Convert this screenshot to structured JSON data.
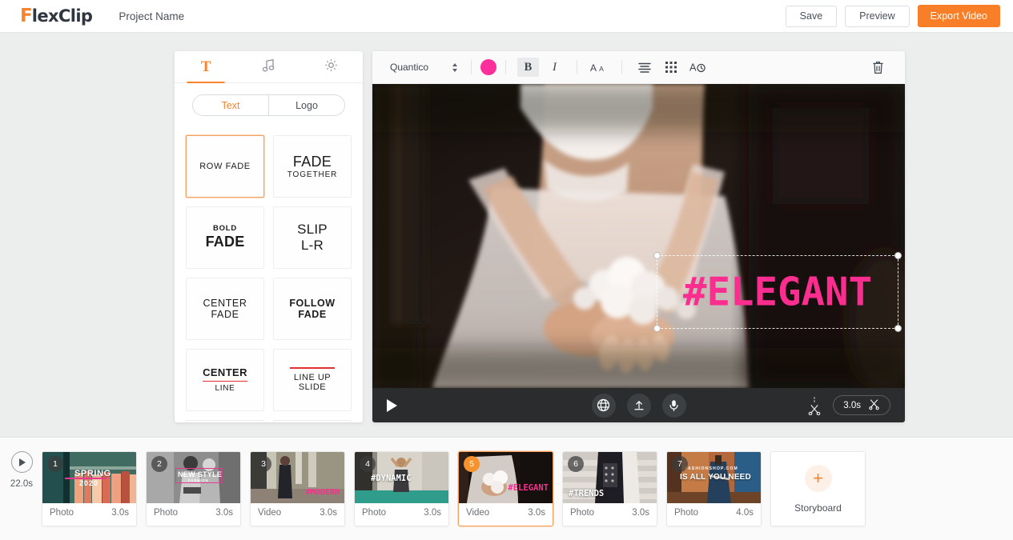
{
  "header": {
    "logo_f": "F",
    "logo_rest": "lexClip",
    "project_name": "Project Name",
    "save_label": "Save",
    "preview_label": "Preview",
    "export_label": "Export Video"
  },
  "left_panel": {
    "tabs": [
      {
        "icon": "text-T-icon",
        "label": "T",
        "active": true
      },
      {
        "icon": "music-note-icon",
        "label": "",
        "active": false
      },
      {
        "icon": "gear-icon",
        "label": "",
        "active": false
      }
    ],
    "segmented": [
      {
        "label": "Text",
        "active": true
      },
      {
        "label": "Logo",
        "active": false
      }
    ],
    "presets": [
      {
        "line1": "ROW FADE",
        "line2": "",
        "style": "rowfade",
        "selected": true
      },
      {
        "line1": "FADE",
        "line2": "TOGETHER",
        "style": "fade",
        "selected": false
      },
      {
        "line1": "BOLD",
        "line2": "FADE",
        "style": "boldfade",
        "selected": false
      },
      {
        "line1": "SLIP",
        "line2": "L-R",
        "style": "slip",
        "selected": false
      },
      {
        "line1": "CENTER",
        "line2": "FADE",
        "style": "centerfade",
        "selected": false
      },
      {
        "line1": "FOLLOW",
        "line2": "FADE",
        "style": "followfade",
        "selected": false
      },
      {
        "line1": "CENTER",
        "line2": "LINE",
        "style": "centerline",
        "selected": false
      },
      {
        "line1": "LINE UP",
        "line2": "SLIDE",
        "style": "lineupslide",
        "selected": false
      }
    ]
  },
  "text_toolbar": {
    "font_name": "Quantico",
    "color": "#fb2e9b",
    "bold_label": "B",
    "italic_label": "I",
    "bold_active": true,
    "icons": [
      "font-size-icon",
      "align-icon",
      "spacing-grid-icon",
      "text-animation-icon",
      "trash-icon"
    ]
  },
  "preview": {
    "overlay_text": "#ELEGANT",
    "overlay_color": "#fb2e8f",
    "player": {
      "play_label": "play-icon",
      "buttons": [
        "globe-icon",
        "upload-icon",
        "microphone-icon"
      ],
      "split_label": "split-icon",
      "duration": "3.0s",
      "trim_label": "scissors-icon"
    }
  },
  "timeline": {
    "total_duration": "22.0s",
    "items": [
      {
        "index": "1",
        "type": "Photo",
        "duration": "3.0s",
        "selected": false,
        "overlay": {
          "kind": "spring",
          "line1": "SPRING",
          "line2": "2020"
        }
      },
      {
        "index": "2",
        "type": "Photo",
        "duration": "3.0s",
        "selected": false,
        "overlay": {
          "kind": "newstyle",
          "line1": "NEW STYLE",
          "line2": "FASHION"
        }
      },
      {
        "index": "3",
        "type": "Video",
        "duration": "3.0s",
        "selected": false,
        "overlay": {
          "kind": "modern",
          "line1": "#MODERN",
          "line2": ""
        }
      },
      {
        "index": "4",
        "type": "Photo",
        "duration": "3.0s",
        "selected": false,
        "overlay": {
          "kind": "dynamic",
          "line1": "#DYNAMIC",
          "line2": ""
        }
      },
      {
        "index": "5",
        "type": "Video",
        "duration": "3.0s",
        "selected": true,
        "overlay": {
          "kind": "elegant",
          "line1": "#ELEGANT",
          "line2": ""
        }
      },
      {
        "index": "6",
        "type": "Photo",
        "duration": "3.0s",
        "selected": false,
        "overlay": {
          "kind": "trends",
          "line1": "#TRENDS",
          "line2": ""
        }
      },
      {
        "index": "7",
        "type": "Photo",
        "duration": "4.0s",
        "selected": false,
        "overlay": {
          "kind": "shop",
          "line1": "FASHIONSHOP.COM",
          "line2": "IS ALL YOU NEED"
        }
      }
    ],
    "add_card": {
      "plus": "+",
      "label": "Storyboard"
    }
  }
}
